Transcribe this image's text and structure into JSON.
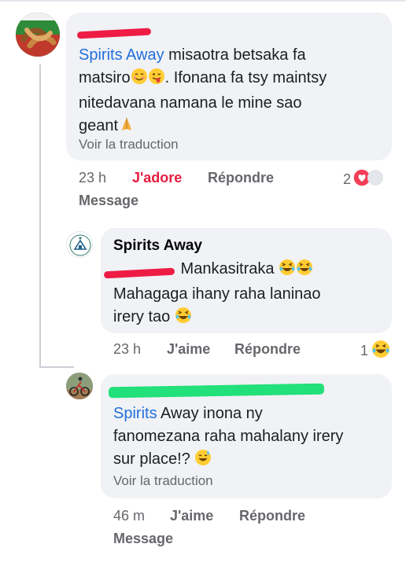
{
  "comments": [
    {
      "author_label": "",
      "mention": "Spirits Away",
      "text_line1": " misaotra betsaka fa",
      "text_line2a": "matsiro",
      "text_line2b": ". Ifonana fa tsy maintsy",
      "text_line3": "nitedavana namana le mine sao",
      "text_line4": "geant",
      "see_translation": "Voir la traduction",
      "time": "23 h",
      "reaction_label": "J'adore",
      "reply_label": "Répondre",
      "message_label": "Message",
      "reaction_count": "2"
    },
    {
      "author_label": "Spirits Away",
      "text_line1": " Mankasitraka ",
      "text_line2": "Mahagaga ihany raha laninao",
      "text_line3": "irery tao ",
      "time": "23 h",
      "like_label": "J'aime",
      "reply_label": "Répondre",
      "reaction_count": "1"
    },
    {
      "mention": "Spirits",
      "text_line1": " Away inona ny",
      "text_line2": "fanomezana raha mahalany irery",
      "text_line3": "sur place!? ",
      "see_translation": "Voir la traduction",
      "time": "46 m",
      "like_label": "J'aime",
      "reply_label": "Répondre",
      "message_label": "Message"
    }
  ],
  "colors": {
    "bubble": "#f0f2f5",
    "link": "#216fdb",
    "love": "#e41e3f",
    "muted": "#65676b",
    "redaction_red": "#ee1c45",
    "redaction_green": "#22e07a"
  }
}
